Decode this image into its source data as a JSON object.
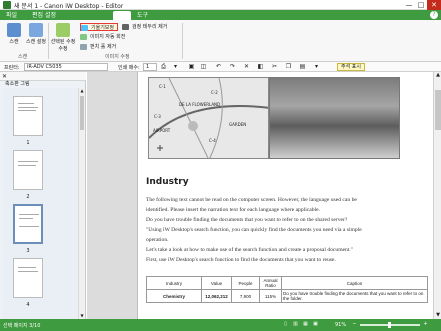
{
  "window": {
    "title": "새 문서 1 - Canon iW Desktop - Editor",
    "minimize": "—",
    "maximize": "□",
    "close": "✕"
  },
  "ribbon_tabs": [
    "파일",
    "편집 설정",
    "",
    "",
    "",
    "도구"
  ],
  "ribbon": {
    "btn_scan": "스캔",
    "btn_scan_settings": "스캔 설정",
    "btn_select": "선택된 수정 수정",
    "small_straighten": "기울기보정",
    "small_rotate": "이미지 자동 회전",
    "small_erase": "펀치 홀 제거",
    "small_auto": "검정 테두리 제거",
    "group_scan": "스캔",
    "group_image": "이미지 수정"
  },
  "toolbar2": {
    "printer_label": "프린터:",
    "printer_value": "iR-ADV C5035",
    "copies_label": "인쇄 매수:",
    "copies_value": "1",
    "memo_button": "주석 표시"
  },
  "left_panel": {
    "close": "✕",
    "tool_label": "축소판 그림",
    "pages": [
      "1",
      "2",
      "3",
      "4"
    ]
  },
  "document": {
    "heading": "Industry",
    "map_labels": [
      "C-1",
      "C-2",
      "C-3",
      "C-4",
      "AIRPORT",
      "GARDEN",
      "DE LA FLOWERLAND"
    ],
    "paragraphs": [
      "The following text cannot be read on the computer screen. However, the language used can be",
      "identified. Please insert the narration text for each language where applicable.",
      "Do you have trouble finding the documents that you want to refer to on the shared server?",
      "\"Using iW Desktop's search function, you can quickly find the documents you need via a simple",
      "operation.",
      "Let's take a look at how to make use of the search function and create a proposal document.\"",
      "First, use iW Desktop's search function to find the documents that you want to reuse."
    ],
    "table_headers": [
      "Industry",
      "Value",
      "People",
      "Annual Ratio",
      "Caption"
    ],
    "table_row": [
      "Chemistry",
      "12,062,212",
      "7,900",
      "115%",
      "Do you have trouble finding the documents that you want to refer to on the folder."
    ]
  },
  "status": {
    "text": "선택 페이지 3/10",
    "zoom": "91%"
  }
}
